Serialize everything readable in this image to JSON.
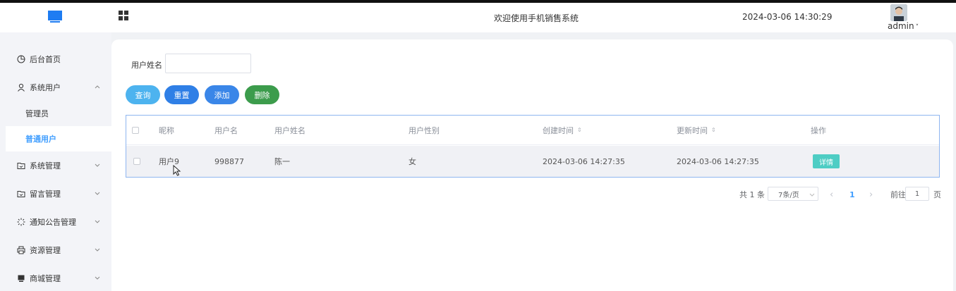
{
  "header": {
    "title": "欢迎使用手机销售系统",
    "datetime": "2024-03-06 14:30:29",
    "username": "admin",
    "dropdown_caret": "˅"
  },
  "sidebar": {
    "items": [
      {
        "label": "后台首页",
        "icon": "clock-pie-icon"
      },
      {
        "label": "系统用户",
        "icon": "person-icon"
      },
      {
        "label": "系统管理",
        "icon": "folder-icon"
      },
      {
        "label": "留言管理",
        "icon": "folder-icon"
      },
      {
        "label": "通知公告管理",
        "icon": "loading-icon"
      },
      {
        "label": "资源管理",
        "icon": "printer-icon"
      },
      {
        "label": "商城管理",
        "icon": "monitor-icon"
      }
    ],
    "sub_items": [
      "管理员",
      "普通用户"
    ],
    "active_sub_item": "普通用户"
  },
  "search": {
    "label": "用户姓名",
    "value": "",
    "placeholder": ""
  },
  "buttons": {
    "query": "查询",
    "reset": "重置",
    "add": "添加",
    "delete": "删除"
  },
  "colors": {
    "query": "#4db3ef",
    "reset": "#2f7fe6",
    "add": "#3a86e8",
    "delete": "#3c9c4c",
    "accent": "#409eff",
    "detail": "#4ecdc4"
  },
  "table": {
    "columns": [
      "昵称",
      "用户名",
      "用户姓名",
      "用户性别",
      "创建时间",
      "更新时间",
      "操作"
    ],
    "sort_glyph": "⇕",
    "rows": [
      {
        "nickname": "用户9",
        "username": "998877",
        "name": "陈一",
        "gender": "女",
        "created": "2024-03-06 14:27:35",
        "updated": "2024-03-06 14:27:35",
        "action": "详情"
      }
    ]
  },
  "pagination": {
    "total": "共 1 条",
    "page_size": "7条/页",
    "prev": "‹",
    "current": "1",
    "next": "›",
    "goto_label": "前往",
    "goto_value": "1",
    "page_suffix": "页"
  }
}
